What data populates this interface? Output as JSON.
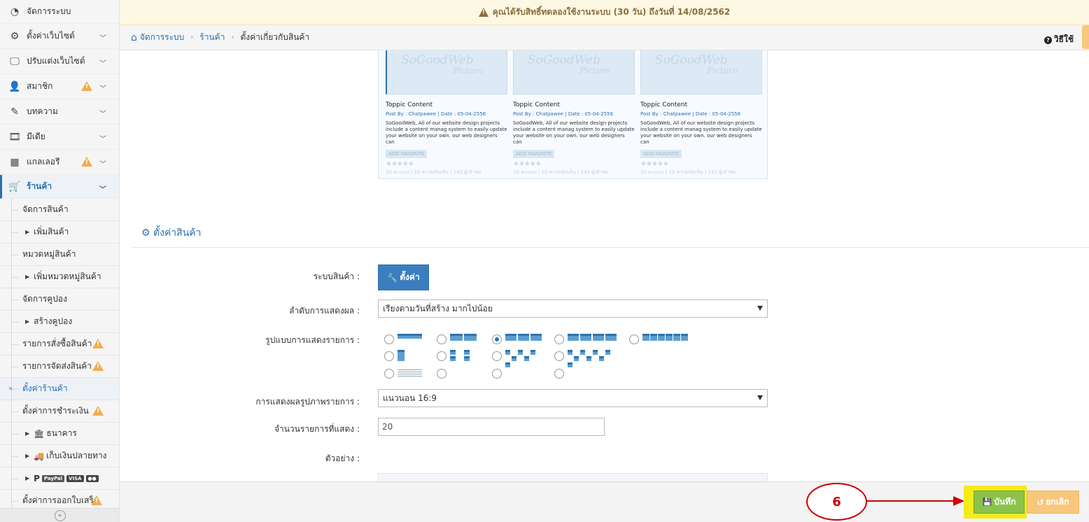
{
  "notice": {
    "text": "คุณได้รับสิทธิ์ทดลองใช้งานระบบ (30 วัน) ถึงวันที่ 14/08/2562"
  },
  "breadcrumb": {
    "home": "จัดการระบบ",
    "shop": "ร้านค้า",
    "current": "ตั้งค่าเกี่ยวกับสินค้า"
  },
  "help_label": "วิธีใช้",
  "sidebar": {
    "items": [
      {
        "label": "จัดการระบบ"
      },
      {
        "label": "ตั้งค่าเว็บไซต์"
      },
      {
        "label": "ปรับแต่งเว็บไซต์"
      },
      {
        "label": "สมาชิก"
      },
      {
        "label": "บทความ"
      },
      {
        "label": "มีเดีย"
      },
      {
        "label": "แกลเลอรี"
      },
      {
        "label": "ร้านค้า"
      }
    ],
    "shop_sub": [
      {
        "label": "จัดการสินค้า"
      },
      {
        "label": "เพิ่มสินค้า"
      },
      {
        "label": "หมวดหมู่สินค้า"
      },
      {
        "label": "เพิ่มหมวดหมู่สินค้า"
      },
      {
        "label": "จัดการคูปอง"
      },
      {
        "label": "สร้างคูปอง"
      },
      {
        "label": "รายการสั่งซื้อสินค้า"
      },
      {
        "label": "รายการจัดส่งสินค้า"
      },
      {
        "label": "ตั้งค่าร้านค้า"
      },
      {
        "label": "ตั้งค่าการชำระเงิน"
      },
      {
        "label": "ธนาคาร"
      },
      {
        "label": "เก็บเงินปลายทาง"
      },
      {
        "label": "ตั้งค่าการออกใบเสร็จ"
      }
    ],
    "payment_badges": [
      "PayPal",
      "VISA"
    ]
  },
  "preview_cards": [
    {
      "brand": "SoGoodWeb",
      "sub": "Picture",
      "title": "Toppic Content",
      "meta": "Post By : Chatpawee  |  Date : 05-04-2556",
      "desc": "SoGoodWeb, All of our website design projects include a content manag system to easily update your website on your own. our web designers can",
      "fav": "ADD FAVORITE",
      "stars": "★★★★★",
      "stats": "20 คะแนน | 10 ความคิดเห็น | 142 ผู้เข้าชม"
    },
    {
      "brand": "SoGoodWeb",
      "sub": "Picture",
      "title": "Toppic Content",
      "meta": "Post By : Chatpawee  |  Date : 05-04-2556",
      "desc": "SoGoodWeb, All of our website design projects include a content manag system to easily update your website on your own. our web designers can",
      "fav": "ADD FAVORITE",
      "stars": "★★★★★",
      "stats": "20 คะแนน | 10 ความคิดเห็น | 142 ผู้เข้าชม"
    },
    {
      "brand": "SoGoodWeb",
      "sub": "Picture",
      "title": "Toppic Content",
      "meta": "Post By : Chatpawee  |  Date : 05-04-2556",
      "desc": "SoGoodWeb, All of our website design projects include a content manag system to easily update your website on your own. our web designers can",
      "fav": "ADD FAVORITE",
      "stars": "★★★★★",
      "stats": "20 คะแนน | 10 ความคิดเห็น | 142 ผู้เข้าชม"
    }
  ],
  "section": {
    "title": "ตั้งค่าสินค้า"
  },
  "form": {
    "system_label": "ระบบสินค้า :",
    "setting_button": "ตั้งค่า",
    "order_label": "ลำดับการแสดงผล :",
    "order_value": "เรียงตามวันที่สร้าง มากไปน้อย",
    "layout_label": "รูปแบบการแสดงรายการ :",
    "layout_selected": "grid-3",
    "image_label": "การแสดงผลรูปภาพรายการ :",
    "image_value": "แนวนอน 16:9",
    "count_label": "จำนวนรายการที่แสดง :",
    "count_value": "20",
    "example_label": "ตัวอย่าง :"
  },
  "footer": {
    "annotation_number": "6",
    "save_label": "บันทึก",
    "cancel_label": "ยกเลิก"
  },
  "colors": {
    "primary": "#2a6fb0",
    "save": "#8bc34a",
    "cancel": "#f7c77c",
    "warning": "#f0ad4e",
    "annotation": "#cc0000"
  }
}
